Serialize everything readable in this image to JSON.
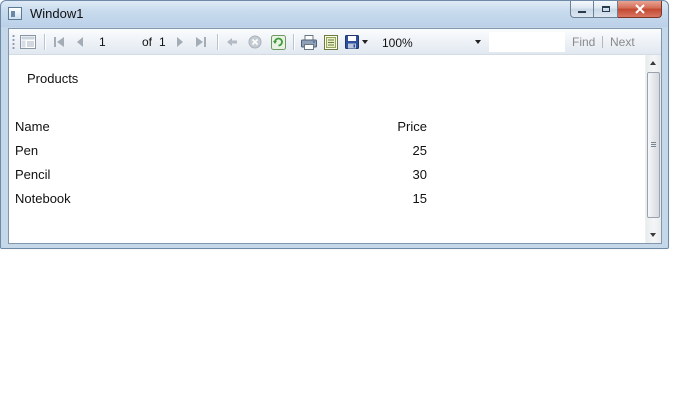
{
  "window": {
    "title": "Window1"
  },
  "toolbar": {
    "page_current": "1",
    "page_of_label": "of",
    "page_total": "1",
    "zoom_value": "100%",
    "find_placeholder": "",
    "find_label": "Find",
    "next_label": "Next",
    "icons": [
      "document-map-icon",
      "first-page-icon",
      "previous-page-icon",
      "next-page-icon",
      "last-page-icon",
      "back-icon",
      "stop-icon",
      "refresh-icon",
      "print-icon",
      "print-layout-icon",
      "export-icon",
      "export-dropdown-icon",
      "zoom-dropdown-icon"
    ]
  },
  "report": {
    "title": "Products",
    "columns": [
      "Name",
      "Price"
    ],
    "rows": [
      {
        "name": "Pen",
        "price": "25"
      },
      {
        "name": "Pencil",
        "price": "30"
      },
      {
        "name": "Notebook",
        "price": "15"
      }
    ]
  },
  "colors": {
    "frame": "#c5d8ea",
    "close_button": "#c2482f",
    "disabled_text": "#8a8a8a",
    "refresh_green": "#3f9a3a",
    "print_blue": "#3b5f9e"
  }
}
